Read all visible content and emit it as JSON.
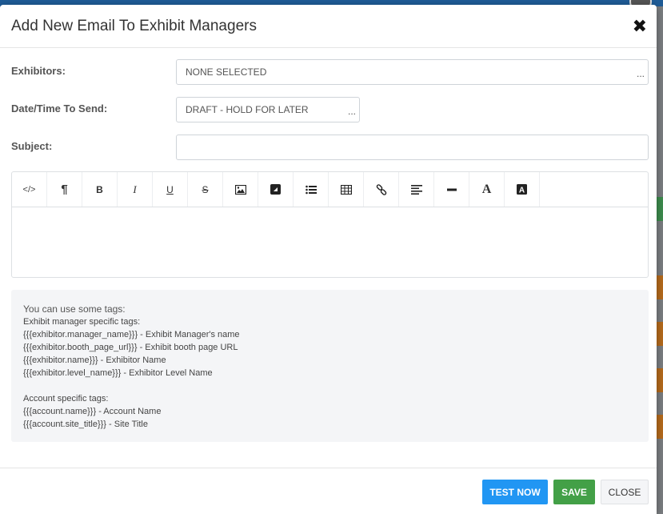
{
  "modal": {
    "title": "Add New Email To Exhibit Managers"
  },
  "form": {
    "exhibitors": {
      "label": "Exhibitors:",
      "value": "NONE SELECTED",
      "more": "..."
    },
    "datetime": {
      "label": "Date/Time To Send:",
      "value": "DRAFT - HOLD FOR LATER",
      "more": "..."
    },
    "subject": {
      "label": "Subject:",
      "value": ""
    }
  },
  "toolbar": {
    "items": [
      "code-view",
      "paragraph",
      "bold",
      "italic",
      "underline",
      "strikethrough",
      "image",
      "video",
      "list",
      "table",
      "link",
      "align",
      "horizontal-rule",
      "font",
      "font-color"
    ],
    "bold": "B",
    "italic": "I",
    "underline": "U",
    "strike": "S",
    "paragraph": "¶",
    "code": "</>"
  },
  "tags": {
    "intro": "You can use some tags:",
    "manager_heading": "Exhibit manager specific tags:",
    "manager_tags": [
      "{{{exhibitor.manager_name}}} - Exhibit Manager's name",
      "{{{exhibitor.booth_page_url}}} - Exhibit booth page URL",
      "{{{exhibitor.name}}} - Exhibitor Name",
      "{{{exhibitor.level_name}}} - Exhibitor Level Name"
    ],
    "account_heading": "Account specific tags:",
    "account_tags": [
      "{{{account.name}}} - Account Name",
      "{{{account.site_title}}} - Site Title"
    ]
  },
  "footer": {
    "test_now": "TEST NOW",
    "save": "SAVE",
    "close": "CLOSE"
  },
  "colors": {
    "primary": "#2196f3",
    "success": "#43a047",
    "header_bar": "#1f5c97"
  }
}
